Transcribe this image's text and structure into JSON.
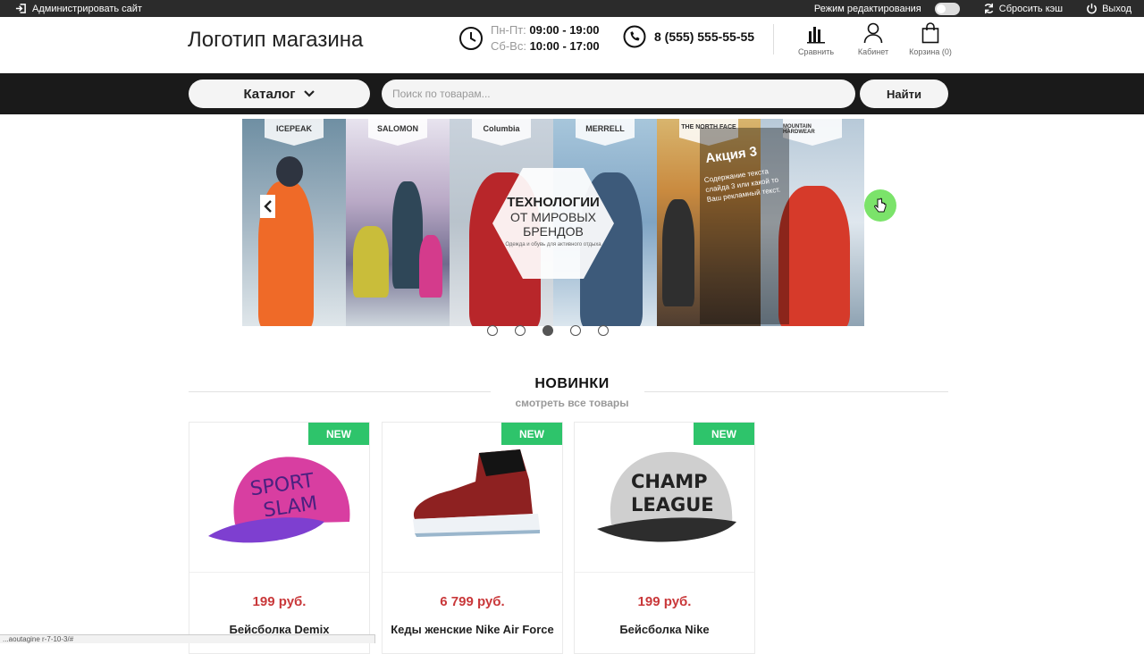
{
  "admin_bar": {
    "admin_link": "Администрировать сайт",
    "edit_mode_label": "Режим редактирования",
    "reset_cache": "Сбросить кэш",
    "logout": "Выход"
  },
  "header": {
    "logo": "Логотип магазина",
    "hours": [
      {
        "days": "Пн-Пт:",
        "time": "09:00 - 19:00"
      },
      {
        "days": "Сб-Вс:",
        "time": "10:00 - 17:00"
      }
    ],
    "phone": "8 (555) 555-55-55",
    "icons": [
      {
        "label": "Сравнить",
        "icon": "chart-icon"
      },
      {
        "label": "Кабинет",
        "icon": "user-icon"
      },
      {
        "label": "Корзина (0)",
        "icon": "bag-icon"
      }
    ]
  },
  "search": {
    "catalog_label": "Каталог",
    "placeholder": "Поиск по товарам...",
    "button_label": "Найти"
  },
  "slider": {
    "brands": [
      "ICEPEAK",
      "SALOMON",
      "Columbia",
      "MERRELL",
      "THE NORTH FACE",
      "MOUNTAIN HARDWEAR"
    ],
    "hex_title": "ТЕХНОЛОГИИ",
    "hex_line2": "ОТ МИРОВЫХ",
    "hex_line3": "БРЕНДОВ",
    "hex_small": "Одежда и обувь для активного отдыха",
    "promo_title": "Акция 3",
    "promo_text": "Содержание текста слайда 3 или какой то Ваш рекламный текст.",
    "active_dot": 3,
    "dot_count": 5
  },
  "section": {
    "title": "НОВИНКИ",
    "link": "смотреть все товары"
  },
  "products": [
    {
      "badge": "NEW",
      "price": "199 руб.",
      "name": "Бейсболка Demix",
      "image": "pink-cap-image",
      "cap_text": "SPORT SLAM",
      "color": "#d83ea1",
      "brim": "#7e3fd0"
    },
    {
      "badge": "NEW",
      "price": "6 799 руб.",
      "name": "Кеды женские Nike Air Force",
      "image": "sneaker-image"
    },
    {
      "badge": "NEW",
      "price": "199 руб.",
      "name": "Бейсболка Nike",
      "image": "grey-cap-image",
      "cap_text": "CHAMP LEAGUE",
      "color": "#c9c9c9",
      "brim": "#333333"
    }
  ],
  "status_url": "...aoutagine r-7-10-3/#"
}
